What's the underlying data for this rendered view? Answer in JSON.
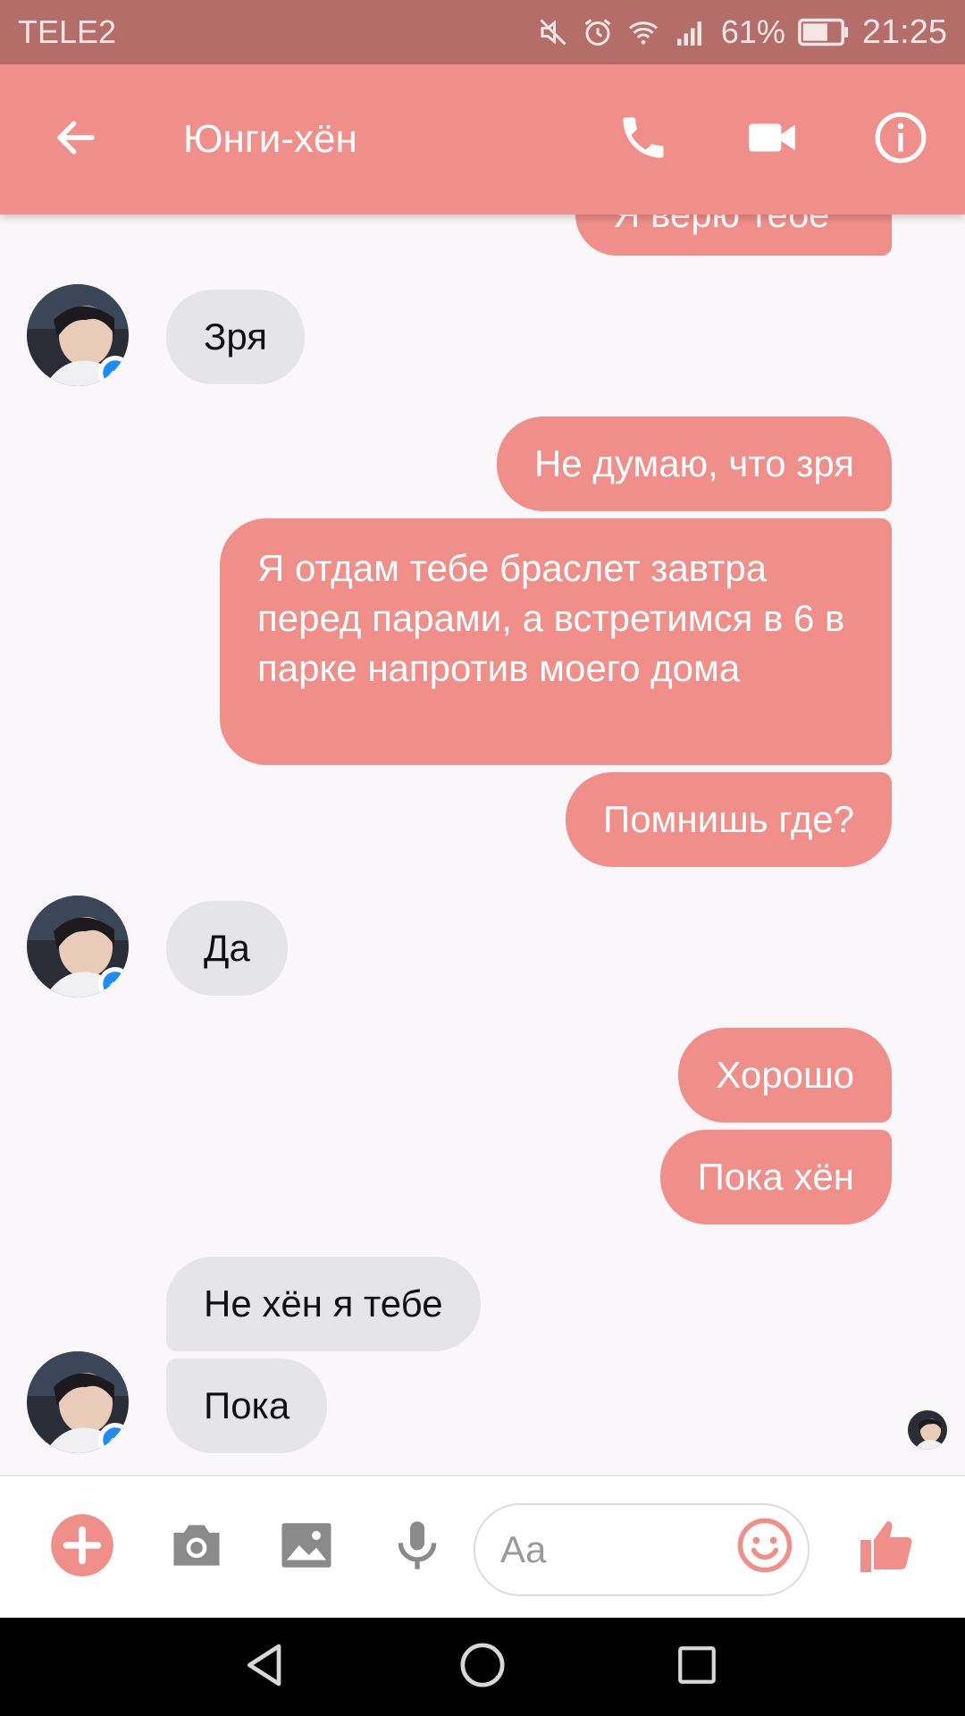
{
  "status_bar": {
    "carrier": "TELE2",
    "battery": "61%",
    "time": "21:25"
  },
  "header": {
    "title": "Юнги-хён"
  },
  "messages": [
    {
      "side": "out",
      "text": "Я верю тебе"
    },
    {
      "side": "in",
      "text": "Зря"
    },
    {
      "side": "out",
      "text": "Не думаю, что зря"
    },
    {
      "side": "out",
      "text": "Я отдам тебе браслет завтра перед парами, а встретимся в 6 в парке напротив моего дома"
    },
    {
      "side": "out",
      "text": "Помнишь где?"
    },
    {
      "side": "in",
      "text": "Да"
    },
    {
      "side": "out",
      "text": "Хорошо"
    },
    {
      "side": "out",
      "text": "Пока хён"
    },
    {
      "side": "in",
      "text": "Не хён я тебе"
    },
    {
      "side": "in",
      "text": "Пока"
    }
  ],
  "composer": {
    "placeholder": "Aa"
  },
  "colors": {
    "accent": "#f08e89",
    "status_bar": "#b46d69",
    "incoming_bubble": "#e5e5e8",
    "background": "#f9f7fa"
  },
  "icons": [
    "back-arrow-icon",
    "phone-icon",
    "video-camera-icon",
    "info-icon",
    "plus-icon",
    "camera-icon",
    "image-icon",
    "microphone-icon",
    "emoji-icon",
    "thumbs-up-icon",
    "messenger-badge-icon"
  ]
}
